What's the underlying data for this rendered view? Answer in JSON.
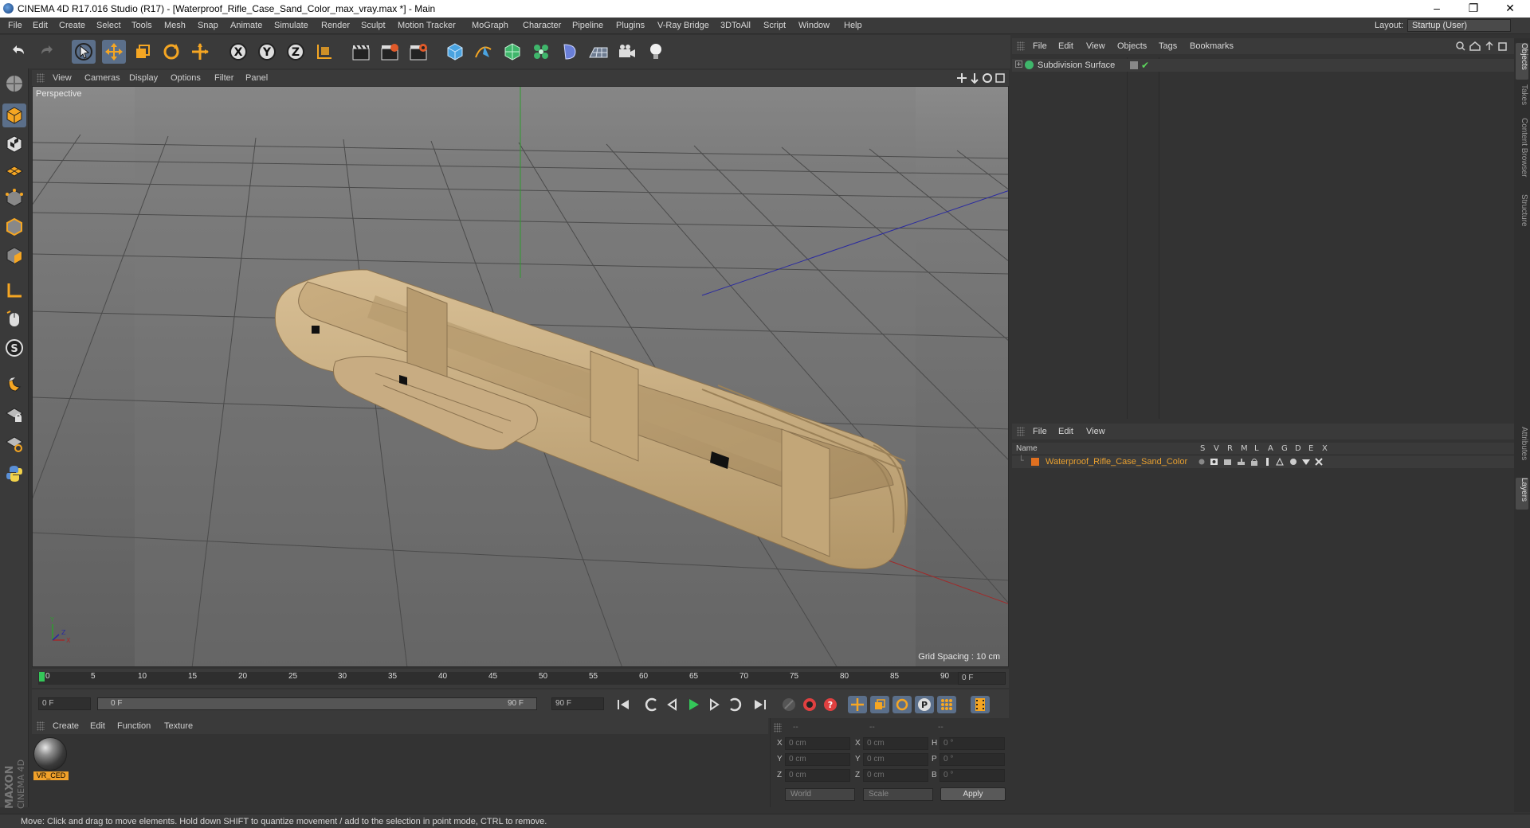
{
  "window": {
    "title": "CINEMA 4D R17.016 Studio (R17) - [Waterproof_Rifle_Case_Sand_Color_max_vray.max *] - Main",
    "minimize": "–",
    "maximize": "❐",
    "close": "✕"
  },
  "menu": [
    "File",
    "Edit",
    "Create",
    "Select",
    "Tools",
    "Mesh",
    "Snap",
    "Animate",
    "Simulate",
    "Render",
    "Sculpt",
    "Motion Tracker",
    "MoGraph",
    "Character",
    "Pipeline",
    "Plugins",
    "V-Ray Bridge",
    "3DToAll",
    "Script",
    "Window",
    "Help"
  ],
  "layout": {
    "label": "Layout:",
    "value": "Startup (User)"
  },
  "viewport": {
    "menu": [
      "View",
      "Cameras",
      "Display",
      "Options",
      "Filter",
      "Panel"
    ],
    "label": "Perspective",
    "grid_spacing": "Grid Spacing : 10 cm"
  },
  "timeline": {
    "ticks": [
      "0",
      "5",
      "10",
      "15",
      "20",
      "25",
      "30",
      "35",
      "40",
      "45",
      "50",
      "55",
      "60",
      "65",
      "70",
      "75",
      "80",
      "85",
      "90"
    ],
    "current_frame": "0 F",
    "start": "0 F",
    "range_start": "0 F",
    "range_end": "90 F",
    "end": "90 F"
  },
  "material_manager": {
    "menu": [
      "Create",
      "Edit",
      "Function",
      "Texture"
    ],
    "materials": [
      {
        "name": "VR_CED"
      }
    ]
  },
  "coordinates": {
    "header": [
      "--",
      "--",
      "--"
    ],
    "rows": [
      {
        "a": "X",
        "av": "0 cm",
        "b": "X",
        "bv": "0 cm",
        "c": "H",
        "cv": "0 °"
      },
      {
        "a": "Y",
        "av": "0 cm",
        "b": "Y",
        "bv": "0 cm",
        "c": "P",
        "cv": "0 °"
      },
      {
        "a": "Z",
        "av": "0 cm",
        "b": "Z",
        "bv": "0 cm",
        "c": "B",
        "cv": "0 °"
      }
    ],
    "space": "World",
    "mode": "Scale",
    "apply": "Apply"
  },
  "status": "Move: Click and drag to move elements. Hold down SHIFT to quantize movement / add to the selection in point mode, CTRL to remove.",
  "object_manager": {
    "menu": [
      "File",
      "Edit",
      "View",
      "Objects",
      "Tags",
      "Bookmarks"
    ],
    "objects": [
      {
        "name": "Subdivision Surface"
      }
    ]
  },
  "layer_manager": {
    "menu": [
      "File",
      "Edit",
      "View"
    ],
    "columns": {
      "name": "Name",
      "flags": [
        "S",
        "V",
        "R",
        "M",
        "L",
        "A",
        "G",
        "D",
        "E",
        "X"
      ]
    },
    "layers": [
      {
        "name": "Waterproof_Rifle_Case_Sand_Color",
        "color": "#e07020"
      }
    ]
  },
  "side_tabs": [
    "Objects",
    "Takes",
    "Content Browser",
    "Structure",
    "Attributes",
    "Layers"
  ],
  "brand": {
    "line1": "MAXON",
    "line2": "CINEMA 4D"
  },
  "colors": {
    "accent": "#5b6f8a",
    "orange": "#f1a12a",
    "sand": "#c8ac82",
    "layer_text": "#e8a030"
  }
}
